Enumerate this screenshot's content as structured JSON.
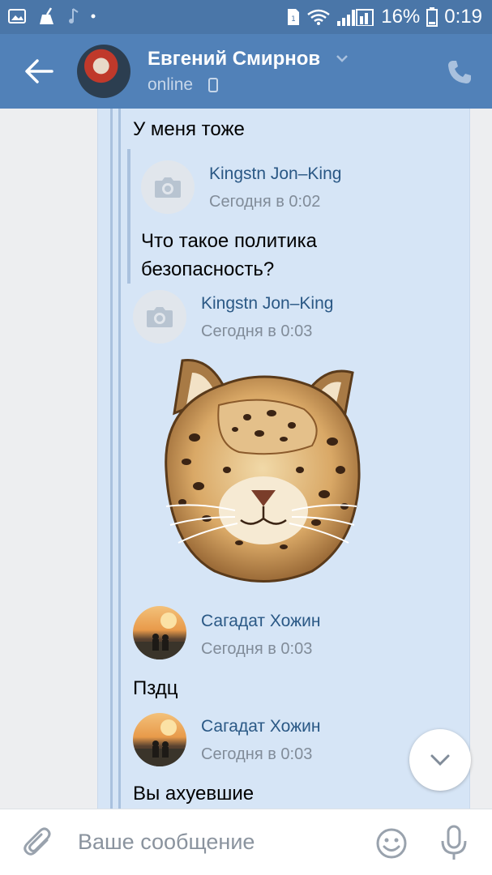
{
  "status_bar": {
    "battery_percent": "16%",
    "time": "0:19",
    "icons": [
      "image-icon",
      "broom-icon",
      "music-icon",
      "dot-icon",
      "sim-icon",
      "wifi-icon",
      "signal-icon",
      "battery-icon"
    ]
  },
  "header": {
    "contact_name": "Евгений Смирнов",
    "status": "online",
    "icons": [
      "back-arrow-icon",
      "chevron-down-icon",
      "mobile-icon",
      "phone-icon"
    ]
  },
  "messages": {
    "m1_text": "У меня тоже",
    "m2_sender": "Kingstn Jon–King",
    "m2_time": "Сегодня в 0:02",
    "m2_text_line1": "Что такое политика",
    "m2_text_line2": "безопасность?",
    "m3_sender": "Kingstn Jon–King",
    "m3_time": "Сегодня в 0:03",
    "m3_sticker": "leopard-sticker",
    "m4_sender": "Сагадат Хожин",
    "m4_time": "Сегодня в 0:03",
    "m4_text": "Пздц",
    "m5_sender": "Сагадат Хожин",
    "m5_time": "Сегодня в 0:03",
    "m5_text": "Вы ахуевшие"
  },
  "composer": {
    "placeholder": "Ваше сообщение",
    "icons": [
      "paperclip-icon",
      "emoji-icon",
      "microphone-icon"
    ]
  },
  "colors": {
    "header_bg": "#5181b8",
    "status_bg": "#4a76a8",
    "forward_panel_bg": "#d6e5f6",
    "link_color": "#2a5885",
    "time_color": "#818c99"
  }
}
